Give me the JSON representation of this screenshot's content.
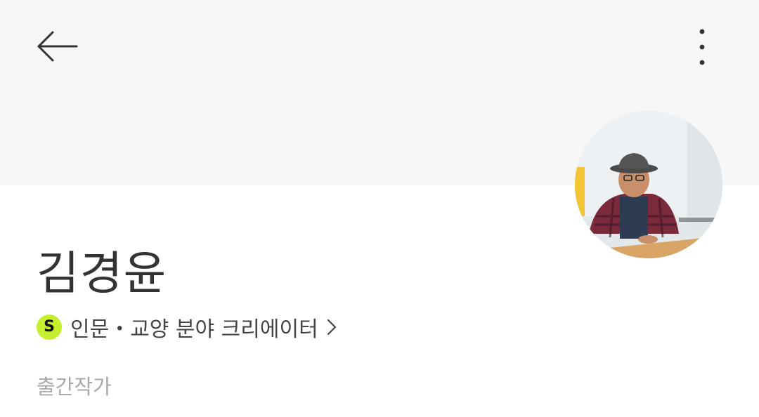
{
  "header": {
    "back_icon": "arrow-left-icon",
    "more_icon": "more-vertical-icon"
  },
  "cover": {
    "background": "#f7f7f7"
  },
  "profile": {
    "name": "김경윤",
    "avatar_icon": "profile-photo",
    "creator_badge_letter": "S",
    "creator_badge_color": "#c6ef2f",
    "creator_label": "인문・교양 분야 크리에이터",
    "role": "출간작가"
  }
}
